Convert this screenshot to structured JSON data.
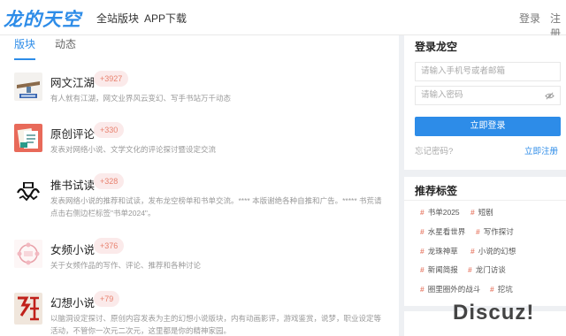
{
  "header": {
    "logo_text": "龙的天空",
    "nav": [
      "全站版块",
      "APP下载"
    ],
    "login": "登录",
    "register": "注册"
  },
  "tabs": [
    {
      "label": "版块",
      "active": true
    },
    {
      "label": "动态",
      "active": false
    }
  ],
  "forums": [
    {
      "title": "网文江湖",
      "count": "+3927",
      "desc": "有人就有江湖，网文业界风云变幻、写手书站万千动态",
      "thumb": "network-sign-icon"
    },
    {
      "title": "原创评论",
      "count": "+330",
      "desc": "发表对网络小说、文学文化的评论探讨暨设定交流",
      "thumb": "documents-icon"
    },
    {
      "title": "推书试读",
      "count": "+328",
      "desc": "发表网络小说的推荐和试读，发布龙空榜单和书单交流。**** 本版谢绝各种自推和广告。***** 书荒请点击右侧边栏标签\"书单2024\"。",
      "thumb": "book-calligraphy-icon"
    },
    {
      "title": "女频小说",
      "count": "+376",
      "desc": "关于女频作品的写作、评论、推荐和各种讨论",
      "thumb": "floral-icon"
    },
    {
      "title": "幻想小说",
      "count": "+79",
      "desc": "以脑洞设定探讨、原创内容发表为主的幻想小说版块，内有动画影评，游戏鉴赏，说梦，职业设定等活动，不管你一次元二次元，这里都是你的精神家园。",
      "thumb": "fantasy-calligraphy-icon"
    }
  ],
  "login": {
    "title": "登录龙空",
    "account_placeholder": "请输入手机号或者邮箱",
    "password_placeholder": "请输入密码",
    "button": "立即登录",
    "forgot": "忘记密码?",
    "register": "立即注册"
  },
  "tags": {
    "title": "推荐标签",
    "items": [
      "书单2025",
      "短剧",
      "水星看世界",
      "写作探讨",
      "龙珠神草",
      "小说的幻想",
      "新闻简报",
      "龙门访谈",
      "圈里圈外的战斗",
      "挖坑"
    ]
  },
  "watermark": "Discuz!",
  "colors": {
    "accent": "#2d8ce8",
    "badge_bg": "#fbeaea",
    "badge_text": "#e8826f"
  }
}
